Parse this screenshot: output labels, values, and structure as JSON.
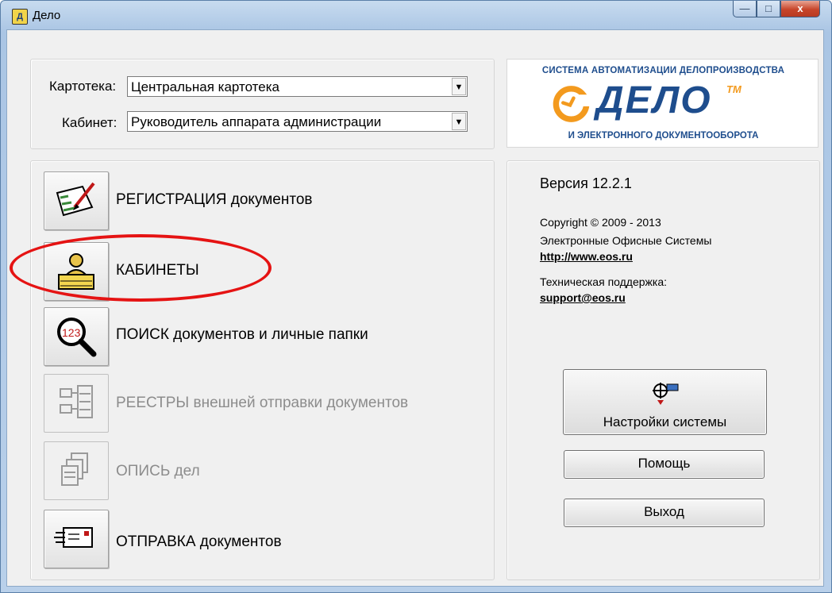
{
  "window": {
    "title": "Дело",
    "app_icon_glyph": "Д",
    "minimize_glyph": "—",
    "maximize_glyph": "□",
    "close_glyph": "x"
  },
  "selectors": {
    "kartoteka": {
      "label": "Картотека:",
      "value": "Центральная картотека"
    },
    "kabinet": {
      "label": "Кабинет:",
      "value": "Руководитель аппарата администрации"
    }
  },
  "logo": {
    "top_text": "СИСТЕМА АВТОМАТИЗАЦИИ ДЕЛОПРОИЗВОДСТВА",
    "word": "ДЕЛО",
    "tm": "TM",
    "bottom_text": "И ЭЛЕКТРОННОГО ДОКУМЕНТООБОРОТА"
  },
  "menu": [
    {
      "key": "registration",
      "label": "РЕГИСТРАЦИЯ  документов",
      "icon": "registration-pen-icon",
      "enabled": true
    },
    {
      "key": "cabinets",
      "label": "КАБИНЕТЫ",
      "icon": "clerk-at-desk-icon",
      "enabled": true
    },
    {
      "key": "search",
      "label": "ПОИСК  документов и личные папки",
      "icon": "magnifier-search-icon",
      "enabled": true
    },
    {
      "key": "registers",
      "label": "РЕЕСТРЫ  внешней отправки документов",
      "icon": "registry-tree-icon",
      "enabled": false
    },
    {
      "key": "inventory",
      "label": "ОПИСЬ дел",
      "icon": "stacked-files-icon",
      "enabled": false
    },
    {
      "key": "sending",
      "label": "ОТПРАВКА документов",
      "icon": "envelope-send-icon",
      "enabled": true
    }
  ],
  "info": {
    "version": "Версия 12.2.1",
    "copyright": "Copyright © 2009 - 2013",
    "company": "Электронные Офисные Системы",
    "url": "http://www.eos.ru",
    "support_label": "Техническая поддержка:",
    "support_email": "support@eos.ru"
  },
  "buttons": {
    "settings": "Настройки системы",
    "help": "Помощь",
    "exit": "Выход"
  },
  "colors": {
    "highlight": "#e51313",
    "brand_blue": "#1e4d8d",
    "brand_orange": "#f39a1e"
  }
}
